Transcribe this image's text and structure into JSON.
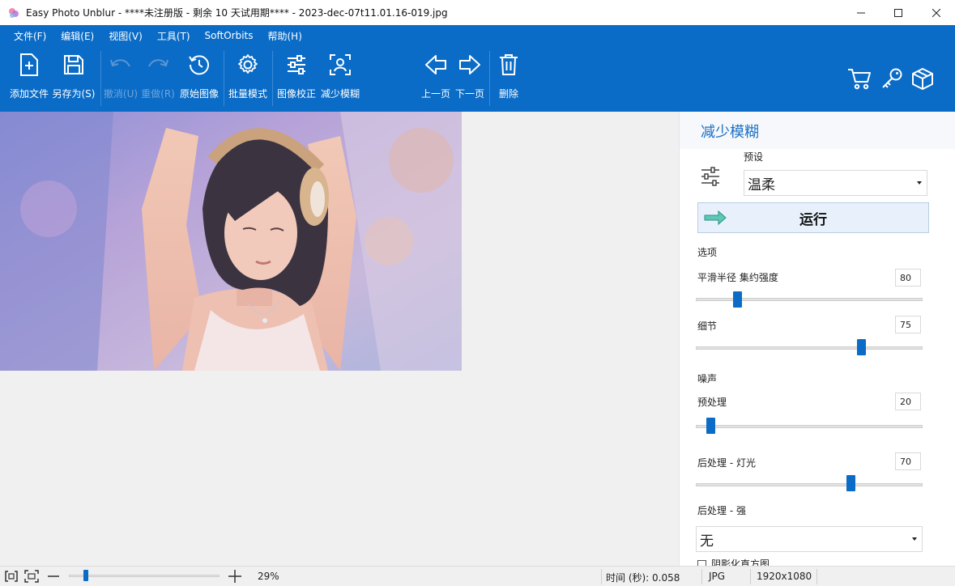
{
  "window": {
    "title": "Easy Photo Unblur - ****未注册版 - 剩余 10 天试用期**** - 2023-dec-07t11.01.16-019.jpg"
  },
  "menu": [
    "文件(F)",
    "编辑(E)",
    "视图(V)",
    "工具(T)",
    "SoftOrbits",
    "帮助(H)"
  ],
  "toolbar": {
    "add_file": "添加文件",
    "save_as": "另存为(S)",
    "undo": "撤消(U)",
    "redo": "重做(R)",
    "original": "原始图像",
    "batch": "批量模式",
    "correction": "图像校正",
    "unblur": "减少模糊",
    "prev": "上一页",
    "next": "下一页",
    "delete": "删除"
  },
  "panel": {
    "title": "减少模糊",
    "preset_label": "预设",
    "preset_value": "温柔",
    "run": "运行",
    "options_label": "选项",
    "smooth_label": "平滑半径 集约强度",
    "smooth_value": "80",
    "smooth_level": 0.17,
    "detail_label": "细节",
    "detail_value": "75",
    "detail_level": 0.74,
    "noise_label": "噪声",
    "pre_label": "预处理",
    "pre_value": "20",
    "pre_level": 0.05,
    "post_light_label": "后处理 - 灯光",
    "post_light_value": "70",
    "post_light_level": 0.69,
    "post_strong_label": "后处理 - 强",
    "post_strong_value": "无",
    "extra_label": "阴影化直方图"
  },
  "status": {
    "zoom": "29%",
    "zoom_level": 0.1,
    "time": "时间 (秒): 0.058",
    "format": "JPG",
    "size": "1920x1080"
  },
  "colors": {
    "accent": "#0a6cc7"
  }
}
